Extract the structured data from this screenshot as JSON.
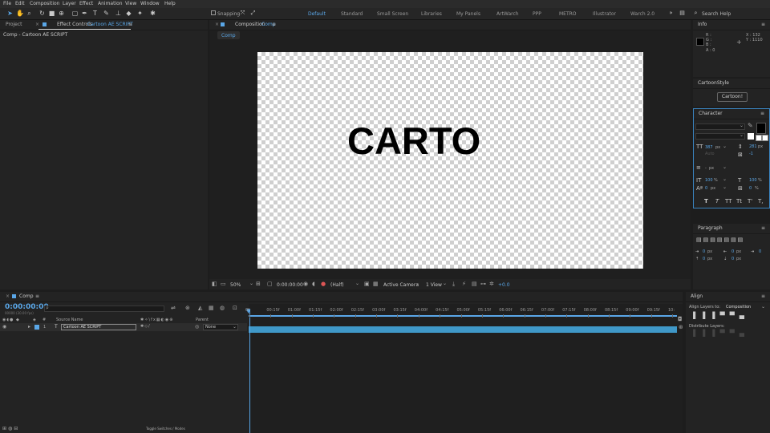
{
  "menu": [
    "File",
    "Edit",
    "Composition",
    "Layer",
    "Effect",
    "Animation",
    "View",
    "Window",
    "Help"
  ],
  "toolbar": {
    "snapping_label": "Snapping",
    "workspaces": [
      "Default",
      "Standard",
      "Small Screen",
      "Libraries",
      "My Panels",
      "ArtWarch",
      "PPP",
      "METRO",
      "Illustrator",
      "Warch 2.0"
    ],
    "active_workspace": "Default",
    "search_placeholder": "Search Help"
  },
  "left_panel": {
    "tab_project": "Project",
    "tab_effect_prefix": "Effect Controls",
    "tab_effect_layer": "Cartoon AE SCRIPT",
    "subtitle": "Comp - Cartoon AE SCRIPT"
  },
  "composition_panel": {
    "tab_prefix": "Composition",
    "tab_name": "Comp",
    "breadcrumb": "Comp",
    "canvas_text": "CARTO",
    "footer": {
      "zoom": "50%",
      "timecode": "0:00:00:00",
      "resolution": "(Half)",
      "camera": "Active Camera",
      "view": "1 View",
      "exposure": "+0.0"
    }
  },
  "info_panel": {
    "title": "Info",
    "r": "R :",
    "g": "G :",
    "b": "B :",
    "a": "A : 0",
    "x": "X : 132",
    "y": "Y : 1110"
  },
  "cartoonstyle_panel": {
    "title": "CartoonStyle",
    "button": "Cartoon!"
  },
  "character_panel": {
    "title": "Character",
    "font_size": "387",
    "font_size_unit": "px",
    "leading": "Auto",
    "kerning": "Metrics",
    "tracking": "281",
    "tracking_unit": "px",
    "tracking2": "-1",
    "stroke": "-",
    "stroke_unit": "px",
    "vscale": "100",
    "vscale_unit": "%",
    "hscale": "100",
    "hscale_unit": "%",
    "baseline": "0",
    "baseline_unit": "px",
    "tsume": "0",
    "tsume_unit": "%",
    "styles": [
      "T",
      "T",
      "TT",
      "Tt",
      "T'",
      "T,"
    ]
  },
  "paragraph_panel": {
    "title": "Paragraph",
    "indent_left": "0",
    "indent_right": "0",
    "space_before": "0",
    "space_after": "0",
    "first_line": "0",
    "unit": "px"
  },
  "timeline": {
    "tab": "Comp",
    "timecode": "0:00:00:00",
    "frame_info": "00000 (30.00 fps)",
    "col_source_name": "Source Name",
    "col_parent": "Parent",
    "layer_index": "1",
    "layer_name": "Cartoon AE SCRIPT",
    "parent_value": "None",
    "ticks": [
      "0f",
      "00:15f",
      "01:00f",
      "01:15f",
      "02:00f",
      "02:15f",
      "03:00f",
      "03:15f",
      "04:00f",
      "04:15f",
      "05:00f",
      "05:15f",
      "06:00f",
      "06:15f",
      "07:00f",
      "07:15f",
      "08:00f",
      "08:15f",
      "09:00f",
      "09:15f",
      "10:"
    ],
    "toggle_label": "Toggle Switches / Modes"
  },
  "align_panel": {
    "title": "Align",
    "align_to_label": "Align Layers to:",
    "align_to_value": "Composition",
    "distribute_label": "Distribute Layers:"
  },
  "colors": {
    "accent": "#5aa7e8",
    "layer_bar": "#3f98c8",
    "panel_bg": "#232323",
    "app_bg": "#1d1d1d"
  }
}
